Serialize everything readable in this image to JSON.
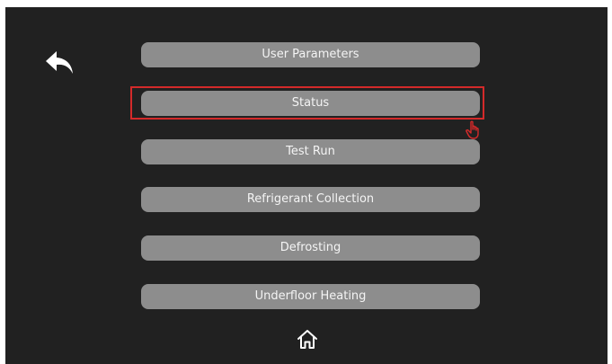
{
  "header": {
    "back_icon": "back-arrow-icon"
  },
  "menu": {
    "items": [
      {
        "label": "User Parameters"
      },
      {
        "label": "Status",
        "selected": true
      },
      {
        "label": "Test Run"
      },
      {
        "label": "Refrigerant Collection"
      },
      {
        "label": "Defrosting"
      },
      {
        "label": "Underfloor Heating"
      }
    ],
    "highlight_color": "#d42a2a",
    "button_color": "#8d8d8d"
  },
  "footer": {
    "home_icon": "home-icon"
  },
  "cursor_icon": "hand-pointer-icon"
}
